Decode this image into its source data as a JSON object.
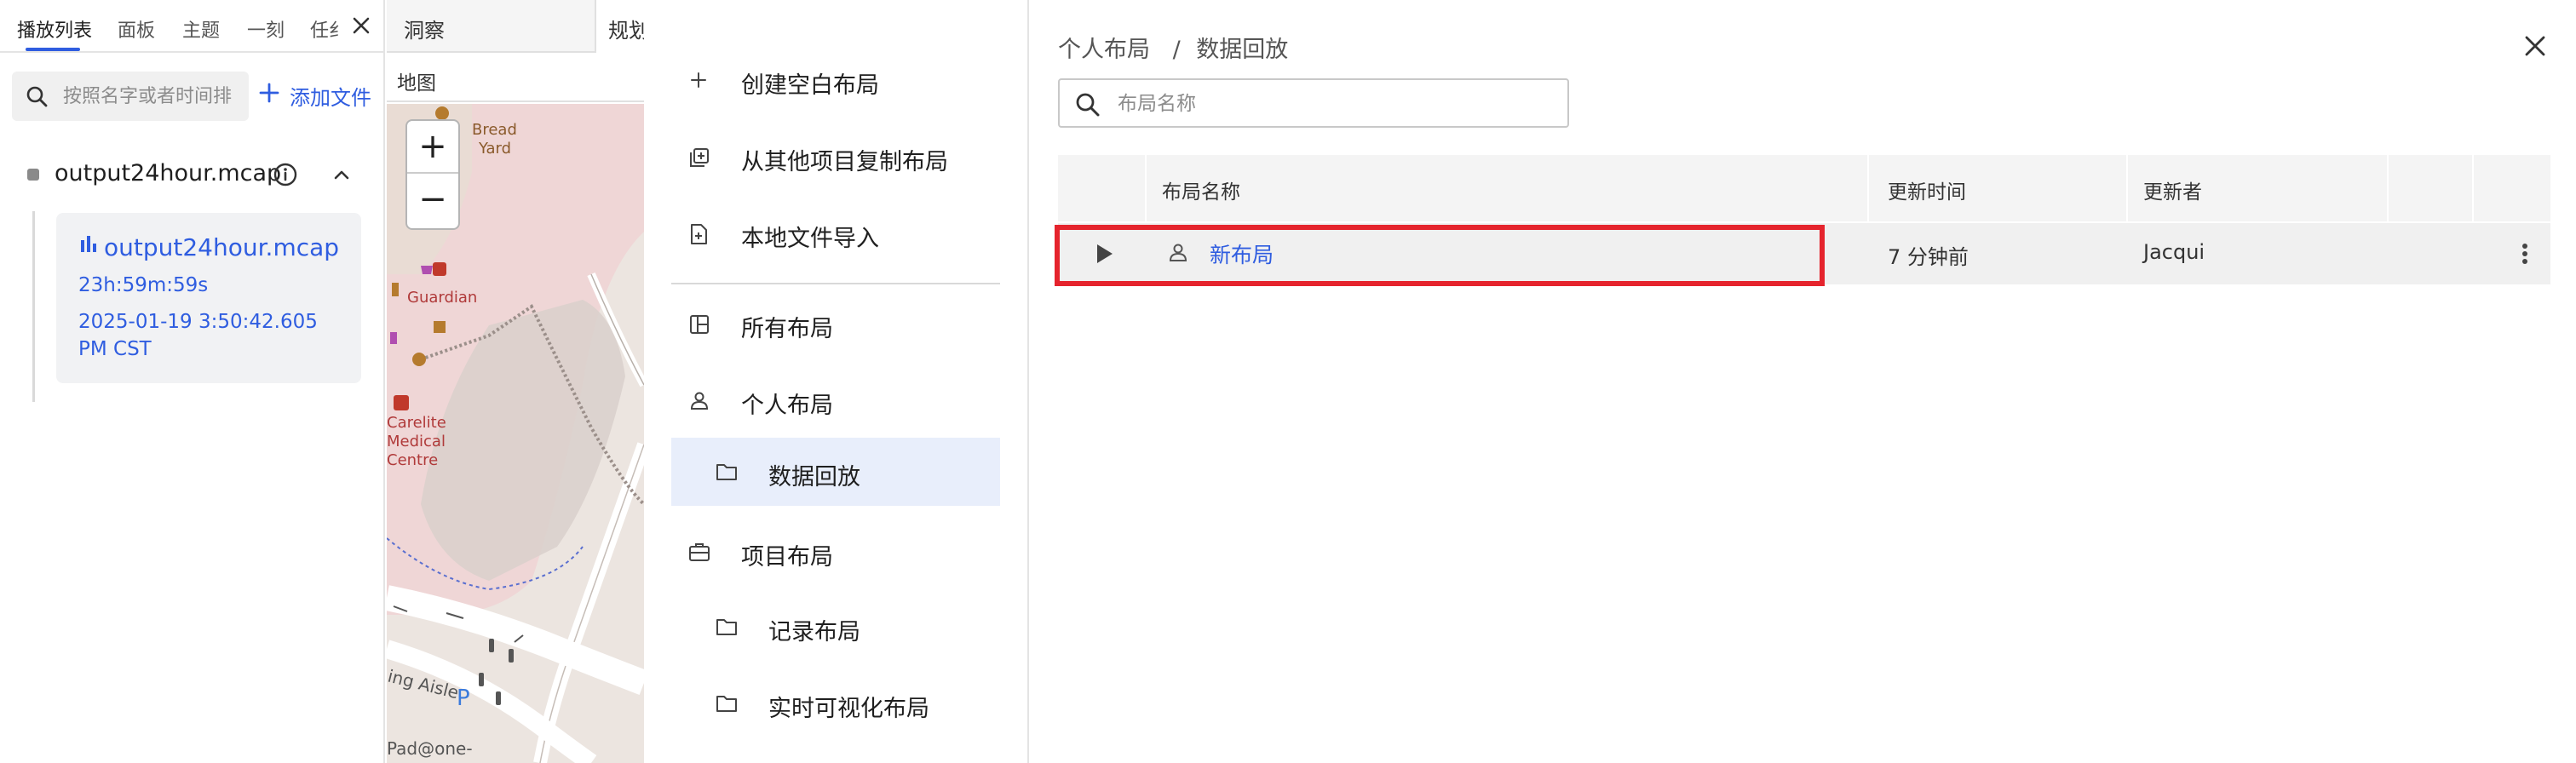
{
  "left_panel": {
    "tabs": [
      {
        "label": "播放列表",
        "active": true
      },
      {
        "label": "面板",
        "active": false
      },
      {
        "label": "主题",
        "active": false
      },
      {
        "label": "一刻",
        "active": false
      },
      {
        "label": "任纟",
        "active": false
      }
    ],
    "search_placeholder": "按照名字或者时间排",
    "add_file_label": "添加文件",
    "file_group": {
      "name": "output24hour.mcap",
      "file": {
        "title": "output24hour.mcap",
        "duration": "23h:59m:59s",
        "date": "2025-01-19 3:50:42.605 PM CST"
      }
    }
  },
  "middle_panel": {
    "tabs": [
      {
        "label": "洞察"
      },
      {
        "label": "规划"
      }
    ],
    "panel_title": "地图",
    "zoom_in": "+",
    "zoom_out": "−",
    "map_labels": {
      "bread_yard_1": "Bread",
      "bread_yard_2": "Yard",
      "guardian": "Guardian",
      "carelite_1": "Carelite",
      "carelite_2": "Medical",
      "carelite_3": "Centre",
      "aisle": "ing Aisle",
      "parking": "P",
      "footer": "Pad@one-"
    }
  },
  "layout_menu": {
    "items": [
      {
        "label": "创建空白布局",
        "icon": "plus-icon"
      },
      {
        "label": "从其他项目复制布局",
        "icon": "copy-icon"
      },
      {
        "label": "本地文件导入",
        "icon": "file-import-icon"
      },
      {
        "label": "所有布局",
        "icon": "layout-grid-icon"
      },
      {
        "label": "个人布局",
        "icon": "person-icon"
      },
      {
        "label": "数据回放",
        "icon": "folder-icon",
        "selected": true
      },
      {
        "label": "项目布局",
        "icon": "briefcase-icon"
      },
      {
        "label": "记录布局",
        "icon": "folder-icon"
      },
      {
        "label": "实时可视化布局",
        "icon": "folder-icon"
      }
    ]
  },
  "right_panel": {
    "breadcrumb": [
      "个人布局",
      "/",
      "数据回放"
    ],
    "search_placeholder": "布局名称",
    "table": {
      "columns": [
        "布局名称",
        "更新时间",
        "更新者"
      ],
      "rows": [
        {
          "name": "新布局",
          "updated": "7 分钟前",
          "updater": "Jacqui"
        }
      ]
    }
  },
  "colors": {
    "accent": "#2f5de0",
    "highlight": "#e5242d",
    "selected_bg": "#e8eefb"
  }
}
